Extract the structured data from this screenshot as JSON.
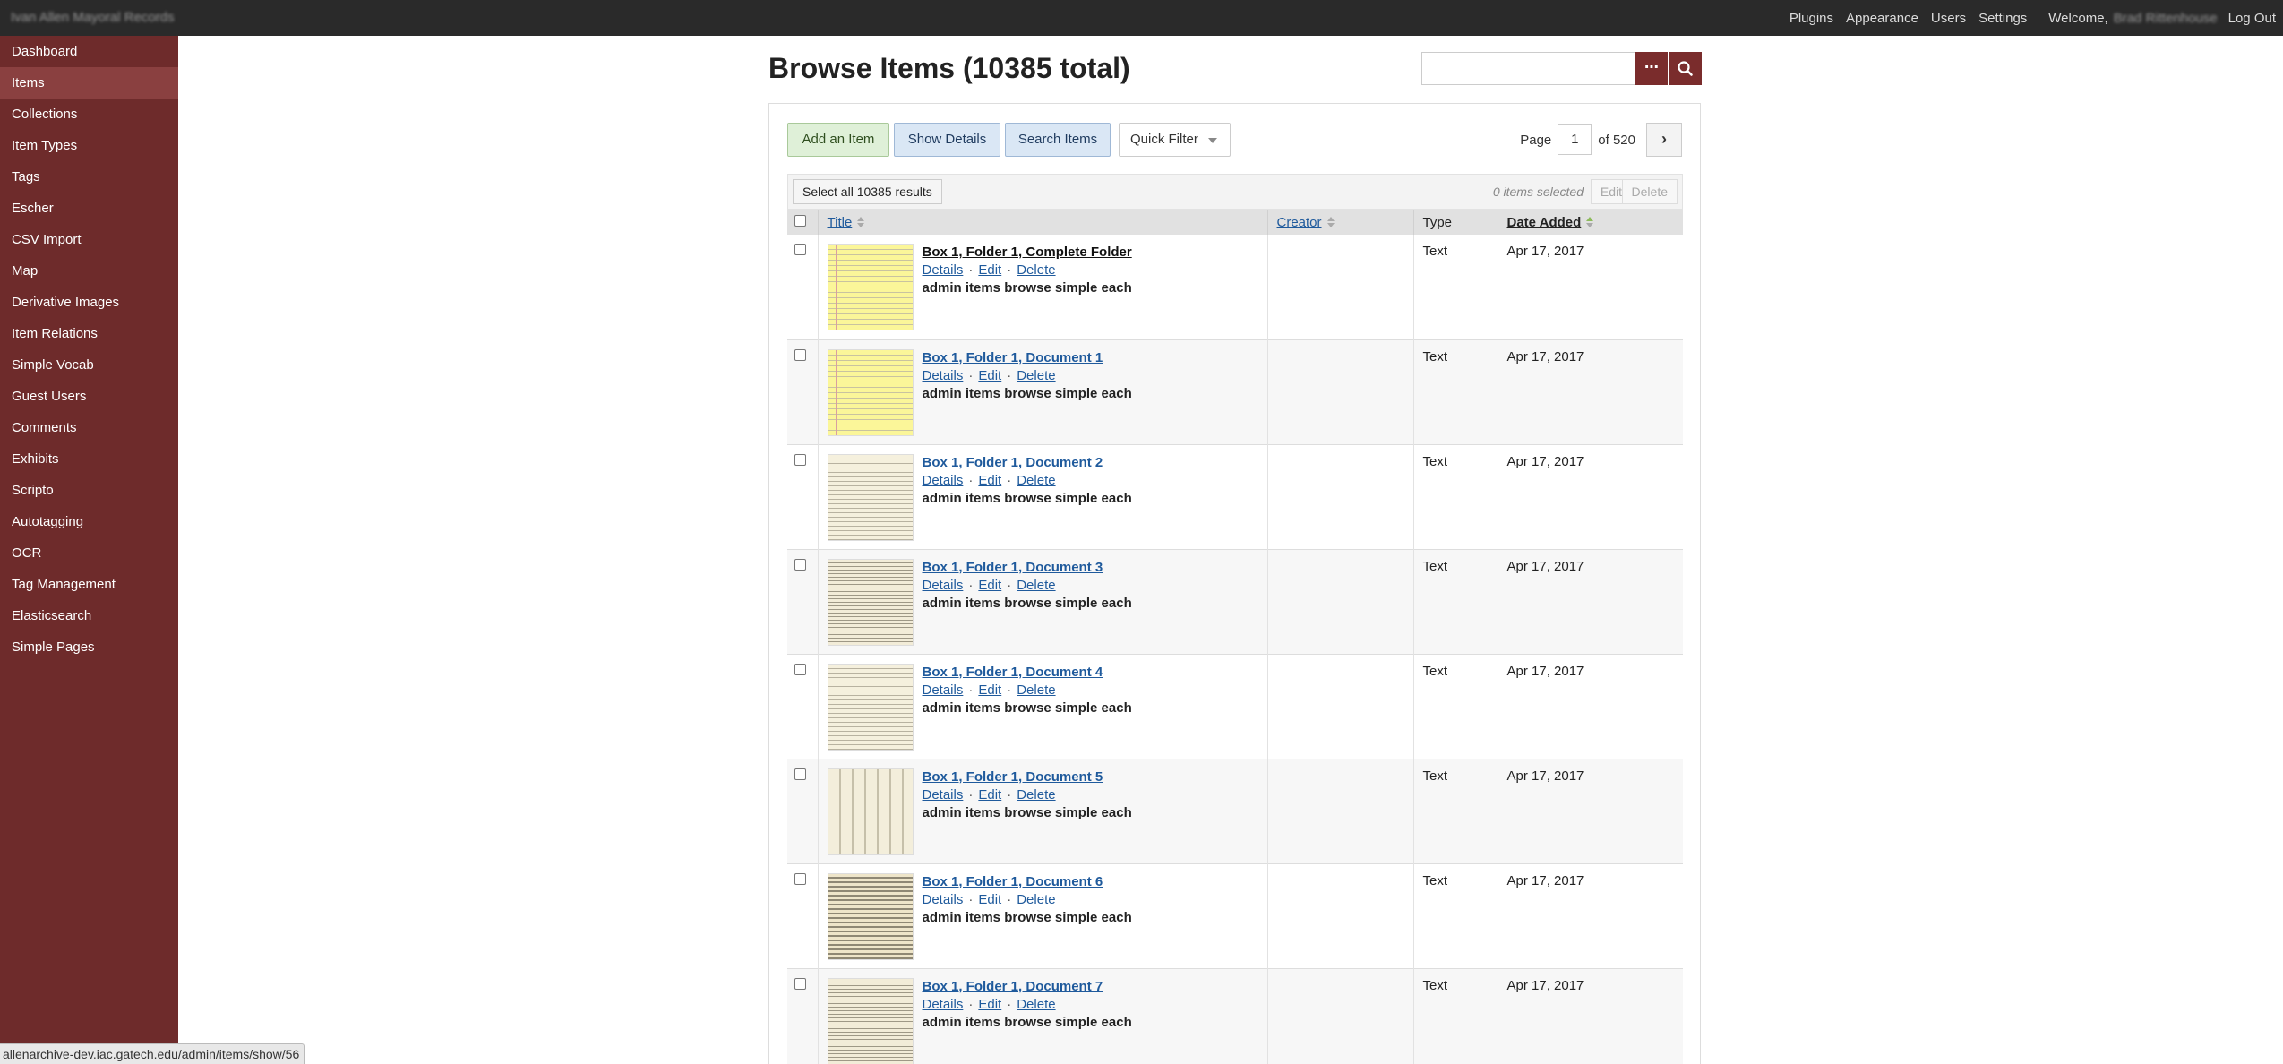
{
  "topbar": {
    "site_title": "Ivan Allen Mayoral Records",
    "nav": [
      "Plugins",
      "Appearance",
      "Users",
      "Settings"
    ],
    "welcome": "Welcome,",
    "user_name": "Brad Rittenhouse",
    "logout": "Log Out"
  },
  "sidebar": {
    "items": [
      {
        "label": "Dashboard"
      },
      {
        "label": "Items"
      },
      {
        "label": "Collections"
      },
      {
        "label": "Item Types"
      },
      {
        "label": "Tags"
      },
      {
        "label": "Escher"
      },
      {
        "label": "CSV Import"
      },
      {
        "label": "Map"
      },
      {
        "label": "Derivative Images"
      },
      {
        "label": "Item Relations"
      },
      {
        "label": "Simple Vocab"
      },
      {
        "label": "Guest Users"
      },
      {
        "label": "Comments"
      },
      {
        "label": "Exhibits"
      },
      {
        "label": "Scripto"
      },
      {
        "label": "Autotagging"
      },
      {
        "label": "OCR"
      },
      {
        "label": "Tag Management"
      },
      {
        "label": "Elasticsearch"
      },
      {
        "label": "Simple Pages"
      }
    ],
    "active_index": 1
  },
  "main": {
    "page_title": "Browse Items (10385 total)",
    "search": {
      "value": "",
      "advanced_icon": "ellipsis-icon",
      "submit_icon": "search-icon"
    },
    "toolbar": {
      "add_label": "Add an Item",
      "details_label": "Show Details",
      "search_label": "Search Items",
      "filter_label": "Quick Filter"
    },
    "pagination": {
      "page_label": "Page",
      "current_page": "1",
      "of_label": "of 520",
      "next_icon": "chevron-right-icon"
    },
    "batch": {
      "select_all_label": "Select all 10385 results",
      "selected_text": "0 items selected",
      "edit_label": "Edit",
      "delete_label": "Delete"
    },
    "table": {
      "columns": {
        "title": "Title",
        "creator": "Creator",
        "type": "Type",
        "date_added": "Date Added"
      },
      "rows": [
        {
          "title": "Box 1, Folder 1, Complete Folder",
          "creator": "",
          "type": "Text",
          "date": "Apr 17, 2017",
          "details": "Details",
          "edit": "Edit",
          "delete": "Delete",
          "hook": "admin items browse simple each"
        },
        {
          "title": "Box 1, Folder 1, Document 1",
          "creator": "",
          "type": "Text",
          "date": "Apr 17, 2017",
          "details": "Details",
          "edit": "Edit",
          "delete": "Delete",
          "hook": "admin items browse simple each"
        },
        {
          "title": "Box 1, Folder 1, Document 2",
          "creator": "",
          "type": "Text",
          "date": "Apr 17, 2017",
          "details": "Details",
          "edit": "Edit",
          "delete": "Delete",
          "hook": "admin items browse simple each"
        },
        {
          "title": "Box 1, Folder 1, Document 3",
          "creator": "",
          "type": "Text",
          "date": "Apr 17, 2017",
          "details": "Details",
          "edit": "Edit",
          "delete": "Delete",
          "hook": "admin items browse simple each"
        },
        {
          "title": "Box 1, Folder 1, Document 4",
          "creator": "",
          "type": "Text",
          "date": "Apr 17, 2017",
          "details": "Details",
          "edit": "Edit",
          "delete": "Delete",
          "hook": "admin items browse simple each"
        },
        {
          "title": "Box 1, Folder 1, Document 5",
          "creator": "",
          "type": "Text",
          "date": "Apr 17, 2017",
          "details": "Details",
          "edit": "Edit",
          "delete": "Delete",
          "hook": "admin items browse simple each"
        },
        {
          "title": "Box 1, Folder 1, Document 6",
          "creator": "",
          "type": "Text",
          "date": "Apr 17, 2017",
          "details": "Details",
          "edit": "Edit",
          "delete": "Delete",
          "hook": "admin items browse simple each"
        },
        {
          "title": "Box 1, Folder 1, Document 7",
          "creator": "",
          "type": "Text",
          "date": "Apr 17, 2017",
          "details": "Details",
          "edit": "Edit",
          "delete": "Delete",
          "hook": "admin items browse simple each"
        }
      ]
    }
  },
  "statusbar": {
    "url": "allenarchive-dev.iac.gatech.edu/admin/items/show/56"
  },
  "colors": {
    "sidebar": "#6e2b2b",
    "topbar": "#2a2a2a",
    "accent": "#7a2c2c",
    "link": "#1f5a9c"
  }
}
